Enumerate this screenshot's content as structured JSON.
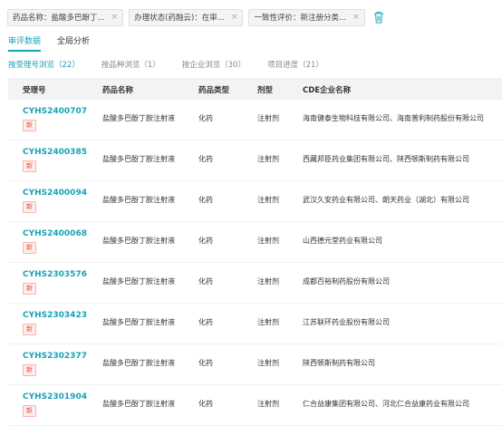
{
  "filters": [
    {
      "text": "药品名称：盐酸多巴酚丁...",
      "close": "×"
    },
    {
      "text": "办理状态(药融云)：在审...",
      "close": "×"
    },
    {
      "text": "一致性评价：新注册分类...",
      "close": "×"
    }
  ],
  "main_tabs": [
    {
      "label": "审评数据",
      "active": true
    },
    {
      "label": "全局分析",
      "active": false
    }
  ],
  "sub_tabs": [
    {
      "label": "按受理号浏览（22）",
      "active": true
    },
    {
      "label": "按品种浏览（1）",
      "active": false
    },
    {
      "label": "按企业浏览（30）",
      "active": false
    },
    {
      "label": "项目进度（21）",
      "active": false
    }
  ],
  "table": {
    "headers": [
      "受理号",
      "药品名称",
      "药品类型",
      "剂型",
      "CDE企业名称"
    ],
    "rows": [
      {
        "code": "CYHS2400707",
        "badge": "新",
        "name": "盐酸多巴酚丁胺注射液",
        "type": "化药",
        "form": "注射剂",
        "company": "海南健泰生物科技有限公司、海南普利制药股份有限公司"
      },
      {
        "code": "CYHS2400385",
        "badge": "新",
        "name": "盐酸多巴酚丁胺注射液",
        "type": "化药",
        "form": "注射剂",
        "company": "西藏邦臣药业集团有限公司、陕西顿斯制药有限公司"
      },
      {
        "code": "CYHS2400094",
        "badge": "新",
        "name": "盐酸多巴酚丁胺注射液",
        "type": "化药",
        "form": "注射剂",
        "company": "武汉久安药业有限公司、朗天药业（湖北）有限公司"
      },
      {
        "code": "CYHS2400068",
        "badge": "新",
        "name": "盐酸多巴酚丁胺注射液",
        "type": "化药",
        "form": "注射剂",
        "company": "山西德元堂药业有限公司"
      },
      {
        "code": "CYHS2303576",
        "badge": "新",
        "name": "盐酸多巴酚丁胺注射液",
        "type": "化药",
        "form": "注射剂",
        "company": "成都百裕制药股份有限公司"
      },
      {
        "code": "CYHS2303423",
        "badge": "新",
        "name": "盐酸多巴酚丁胺注射液",
        "type": "化药",
        "form": "注射剂",
        "company": "江苏联环药业股份有限公司"
      },
      {
        "code": "CYHS2302377",
        "badge": "新",
        "name": "盐酸多巴酚丁胺注射液",
        "type": "化药",
        "form": "注射剂",
        "company": "陕西顿斯制药有限公司"
      },
      {
        "code": "CYHS2301904",
        "badge": "新",
        "name": "盐酸多巴酚丁胺注射液",
        "type": "化药",
        "form": "注射剂",
        "company": "仁合益康集团有限公司、河北仁合益康药业有限公司"
      }
    ]
  },
  "colors": {
    "accent": "#17a2b8",
    "badge": "#e74c3c"
  }
}
